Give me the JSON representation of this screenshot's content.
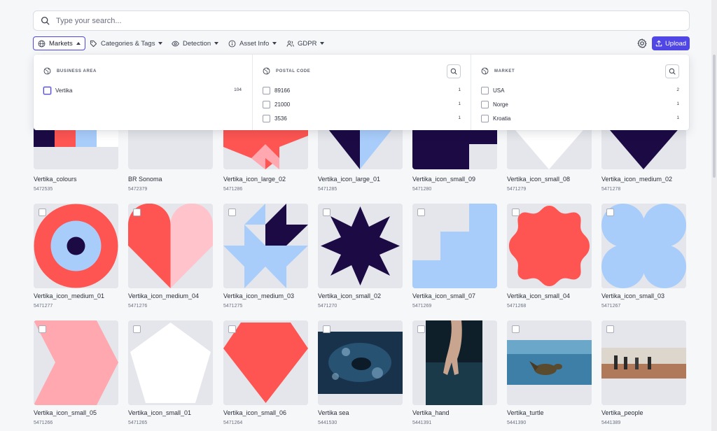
{
  "search": {
    "placeholder": "Type your search..."
  },
  "toolbar": {
    "filters": [
      {
        "label": "Markets",
        "icon": "globe-icon",
        "active": true
      },
      {
        "label": "Categories & Tags",
        "icon": "tags-icon"
      },
      {
        "label": "Detection",
        "icon": "eye-icon"
      },
      {
        "label": "Asset Info",
        "icon": "info-icon"
      },
      {
        "label": "GDPR",
        "icon": "users-icon"
      }
    ],
    "upload_label": "Upload"
  },
  "markets_dropdown": {
    "columns": [
      {
        "heading": "BUSINESS AREA",
        "searchable": false,
        "options": [
          {
            "label": "Vertika",
            "count": "104"
          }
        ]
      },
      {
        "heading": "POSTAL CODE",
        "searchable": true,
        "options": [
          {
            "label": "89166",
            "count": "1"
          },
          {
            "label": "21000",
            "count": "1"
          },
          {
            "label": "3536",
            "count": "1"
          }
        ]
      },
      {
        "heading": "MARKET",
        "searchable": true,
        "options": [
          {
            "label": "USA",
            "count": "2"
          },
          {
            "label": "Norge",
            "count": "1"
          },
          {
            "label": "Kroatia",
            "count": "1"
          }
        ]
      }
    ]
  },
  "assets": [
    {
      "name": "Vertika_colours",
      "id": "5472535"
    },
    {
      "name": "BR Sonoma",
      "id": "5472379"
    },
    {
      "name": "Vertika_icon_large_02",
      "id": "5471286"
    },
    {
      "name": "Vertika_icon_large_01",
      "id": "5471285"
    },
    {
      "name": "Vertika_icon_small_09",
      "id": "5471280"
    },
    {
      "name": "Vertika_icon_small_08",
      "id": "5471279"
    },
    {
      "name": "Vertika_icon_medium_02",
      "id": "5471278"
    },
    {
      "name": "Vertika_icon_medium_01",
      "id": "5471277"
    },
    {
      "name": "Vertika_icon_medium_04",
      "id": "5471276"
    },
    {
      "name": "Vertika_icon_medium_03",
      "id": "5471275"
    },
    {
      "name": "Vertika_icon_small_02",
      "id": "5471270"
    },
    {
      "name": "Vertika_icon_small_07",
      "id": "5471269"
    },
    {
      "name": "Vertika_icon_small_04",
      "id": "5471268"
    },
    {
      "name": "Vertika_icon_small_03",
      "id": "5471267"
    },
    {
      "name": "Vertika_icon_small_05",
      "id": "5471266"
    },
    {
      "name": "Vertika_icon_small_01",
      "id": "5471265"
    },
    {
      "name": "Vertika_icon_small_06",
      "id": "5471264"
    },
    {
      "name": "Vertika sea",
      "id": "5441530"
    },
    {
      "name": "Vertika_hand",
      "id": "5441391"
    },
    {
      "name": "Vertika_turtle",
      "id": "5441390"
    },
    {
      "name": "Vertika_people",
      "id": "5441389"
    }
  ],
  "colors": {
    "accent": "#4f46e5",
    "coral": "#fe5552",
    "pink": "#ffa8b0",
    "light_blue": "#a9cdfb",
    "navy": "#1c0a45"
  }
}
